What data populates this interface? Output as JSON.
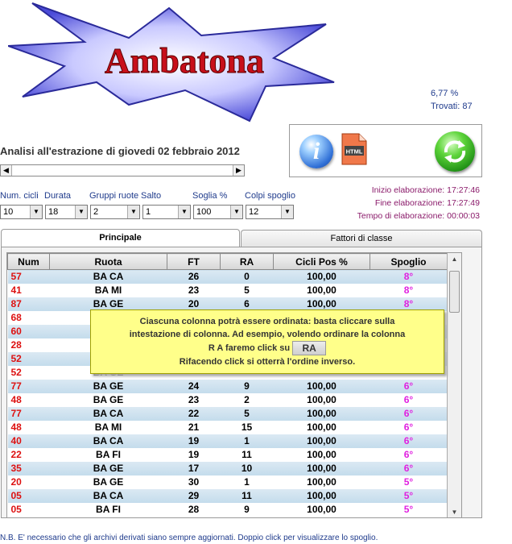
{
  "logo": {
    "title": "Ambatona"
  },
  "stats": {
    "percent": "6,77 %",
    "found": "Trovati: 87"
  },
  "toolbar": {
    "info_label": "i",
    "html_label": "HTML"
  },
  "analysis_title": "Analisi all'estrazione di giovedi 02 febbraio 2012",
  "timing": {
    "start": "Inizio elaborazione: 17:27:46",
    "end": "Fine elaborazione: 17:27:49",
    "elapsed": "Tempo di elaborazione: 00:00:03"
  },
  "filters": {
    "num_cicli": {
      "label": "Num. cicli",
      "value": "10"
    },
    "durata": {
      "label": "Durata",
      "value": "18"
    },
    "gruppi_ruote": {
      "label": "Gruppi ruote",
      "value": "2"
    },
    "salto": {
      "label": "Salto",
      "value": "1"
    },
    "soglia": {
      "label": "Soglia %",
      "value": "100"
    },
    "colpi_spoglio": {
      "label": "Colpi spoglio",
      "value": "12"
    }
  },
  "tabs": {
    "principale": "Principale",
    "fattori": "Fattori di classe"
  },
  "table": {
    "headers": [
      "Num",
      "Ruota",
      "FT",
      "RA",
      "Cicli Pos %",
      "Spoglio"
    ],
    "rows": [
      [
        "57",
        "BA CA",
        "26",
        "0",
        "100,00",
        "8°"
      ],
      [
        "41",
        "BA MI",
        "23",
        "5",
        "100,00",
        "8°"
      ],
      [
        "87",
        "BA GE",
        "20",
        "6",
        "100,00",
        "8°"
      ],
      [
        "68",
        "",
        "",
        "",
        "",
        ""
      ],
      [
        "60",
        "",
        "",
        "",
        "",
        ""
      ],
      [
        "28",
        "",
        "",
        "",
        "",
        ""
      ],
      [
        "52",
        "",
        "",
        "",
        "",
        ""
      ],
      [
        "52",
        "BA GE",
        "",
        "",
        "",
        ""
      ],
      [
        "77",
        "BA GE",
        "24",
        "9",
        "100,00",
        "6°"
      ],
      [
        "48",
        "BA GE",
        "23",
        "2",
        "100,00",
        "6°"
      ],
      [
        "77",
        "BA CA",
        "22",
        "5",
        "100,00",
        "6°"
      ],
      [
        "48",
        "BA MI",
        "21",
        "15",
        "100,00",
        "6°"
      ],
      [
        "40",
        "BA CA",
        "19",
        "1",
        "100,00",
        "6°"
      ],
      [
        "22",
        "BA FI",
        "19",
        "11",
        "100,00",
        "6°"
      ],
      [
        "35",
        "BA GE",
        "17",
        "10",
        "100,00",
        "6°"
      ],
      [
        "20",
        "BA GE",
        "30",
        "1",
        "100,00",
        "5°"
      ],
      [
        "05",
        "BA CA",
        "29",
        "11",
        "100,00",
        "5°"
      ],
      [
        "05",
        "BA FI",
        "28",
        "9",
        "100,00",
        "5°"
      ]
    ]
  },
  "tooltip": {
    "line1": "Ciascuna colonna potrà essere ordinata: basta cliccare sulla",
    "line2": "intestazione di colonna. Ad esempio, volendo ordinare la colonna",
    "line3": "R A faremo click su",
    "ra_button": "RA",
    "line4": "Rifacendo click si otterrà l'ordine inverso."
  },
  "note": "N.B. E' necessario che gli archivi derivati siano sempre aggiornati. Doppio click per visualizzare lo spoglio."
}
